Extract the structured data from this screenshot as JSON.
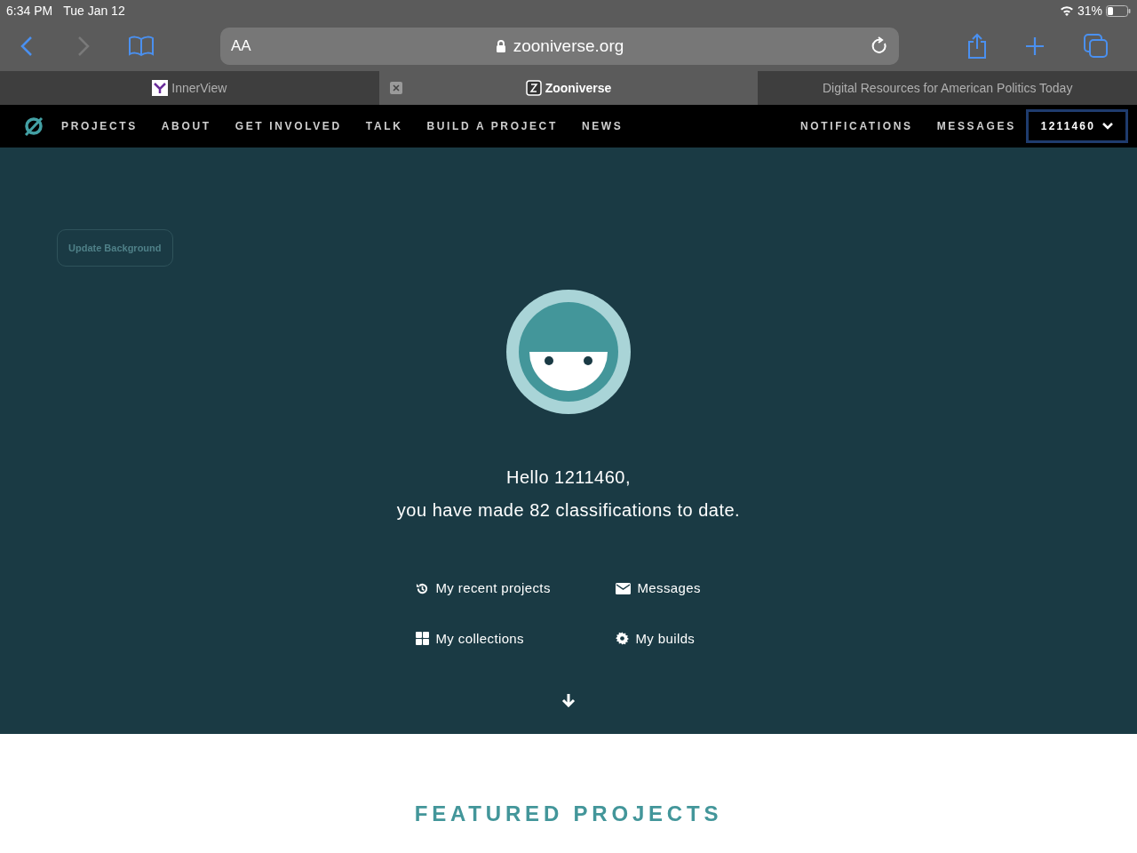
{
  "status_bar": {
    "time": "6:34 PM",
    "date": "Tue Jan 12",
    "battery": "31%"
  },
  "toolbar": {
    "reader_label": "AA",
    "url": "zooniverse.org"
  },
  "tabs": [
    {
      "label": "InnerView",
      "kind": "innerview",
      "selected": false
    },
    {
      "label": "Zooniverse",
      "kind": "zooniverse",
      "selected": true
    },
    {
      "label": "Digital Resources for American Politics Today",
      "kind": "none",
      "selected": false
    }
  ],
  "site_nav": {
    "left": [
      "PROJECTS",
      "ABOUT",
      "GET INVOLVED",
      "TALK",
      "BUILD A PROJECT",
      "NEWS"
    ],
    "right": [
      "NOTIFICATIONS",
      "MESSAGES"
    ],
    "user_menu": "1211460"
  },
  "hero": {
    "update_background": "Update Background",
    "greeting": "Hello 1211460,",
    "summary": "you have made 82 classifications to date.",
    "links": [
      {
        "label": "My recent projects",
        "kind": "history"
      },
      {
        "label": "Messages",
        "kind": "envelope"
      },
      {
        "label": "My collections",
        "kind": "grid"
      },
      {
        "label": "My builds",
        "kind": "gear"
      }
    ]
  },
  "featured": {
    "heading": "FEATURED PROJECTS"
  }
}
